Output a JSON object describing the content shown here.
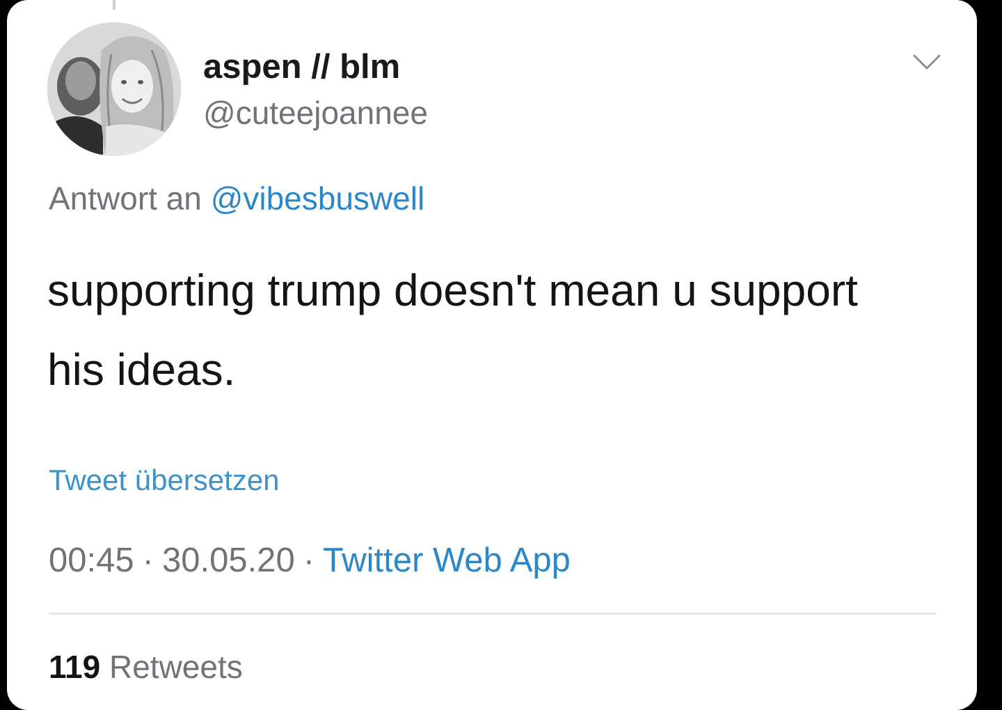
{
  "tweet": {
    "author": {
      "display_name": "aspen // blm",
      "handle": "@cuteejoannee",
      "avatar_icon": "profile-photo"
    },
    "reply_to": {
      "prefix": "Antwort an ",
      "mention": "@vibesbuswell"
    },
    "text": "supporting trump doesn't mean u support his ideas.",
    "translate_label": "Tweet übersetzen",
    "meta": {
      "time": "00:45",
      "separator": "·",
      "date": "30.05.20",
      "source": "Twitter Web App"
    },
    "stats": {
      "retweet_count": "119",
      "retweet_label": "Retweets"
    },
    "menu_icon": "chevron-down-icon"
  },
  "colors": {
    "link": "#2b87c8",
    "secondary_text": "#6f7378",
    "primary_text": "#141414"
  }
}
